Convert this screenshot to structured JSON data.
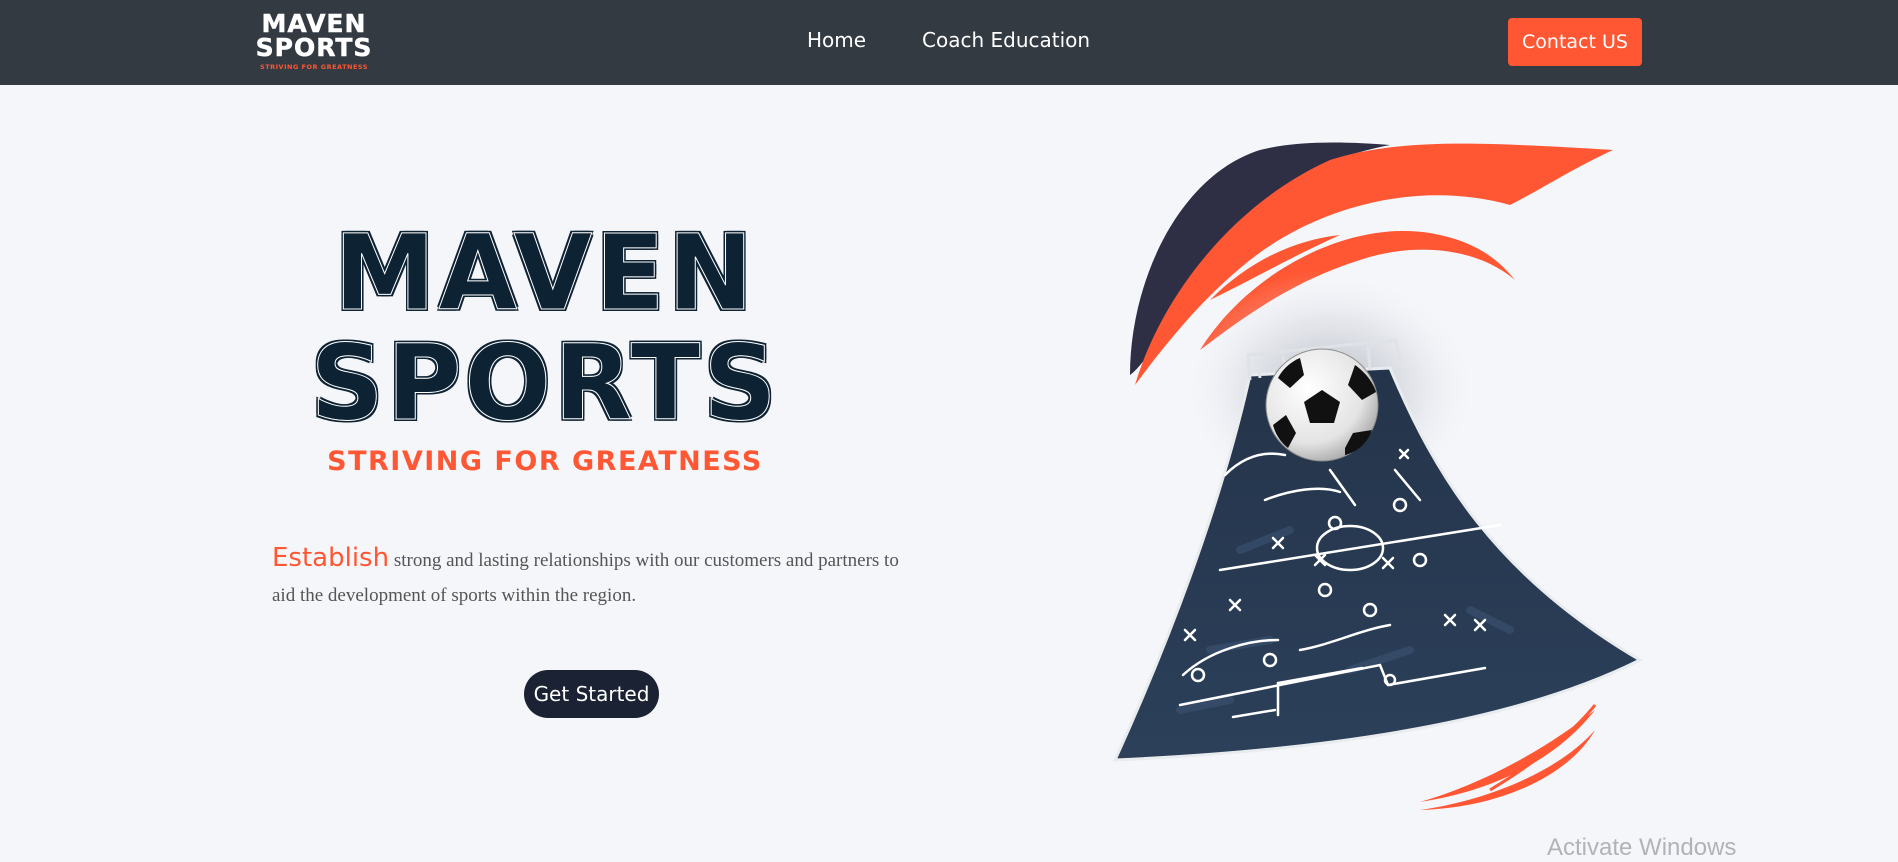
{
  "nav": {
    "logo_line1": "MAVEN",
    "logo_line2": "SPORTS",
    "logo_tagline": "STRIVING FOR GREATNESS",
    "links": [
      "Home",
      "Coach Education"
    ],
    "contact_label": "Contact US"
  },
  "hero": {
    "title_line1": "MAVEN",
    "title_line2": "SPORTS",
    "subtitle": "STRIVING FOR GREATNESS",
    "highlight_word": "Establish",
    "description": "strong and lasting relationships with our customers and partners to aid the development of sports within the region.",
    "cta_label": "Get Started"
  },
  "watermark": "Activate Windows",
  "colors": {
    "nav_bg": "#343a42",
    "accent": "#ff5733",
    "navy": "#0d2233",
    "page_bg": "#f5f6fa"
  }
}
